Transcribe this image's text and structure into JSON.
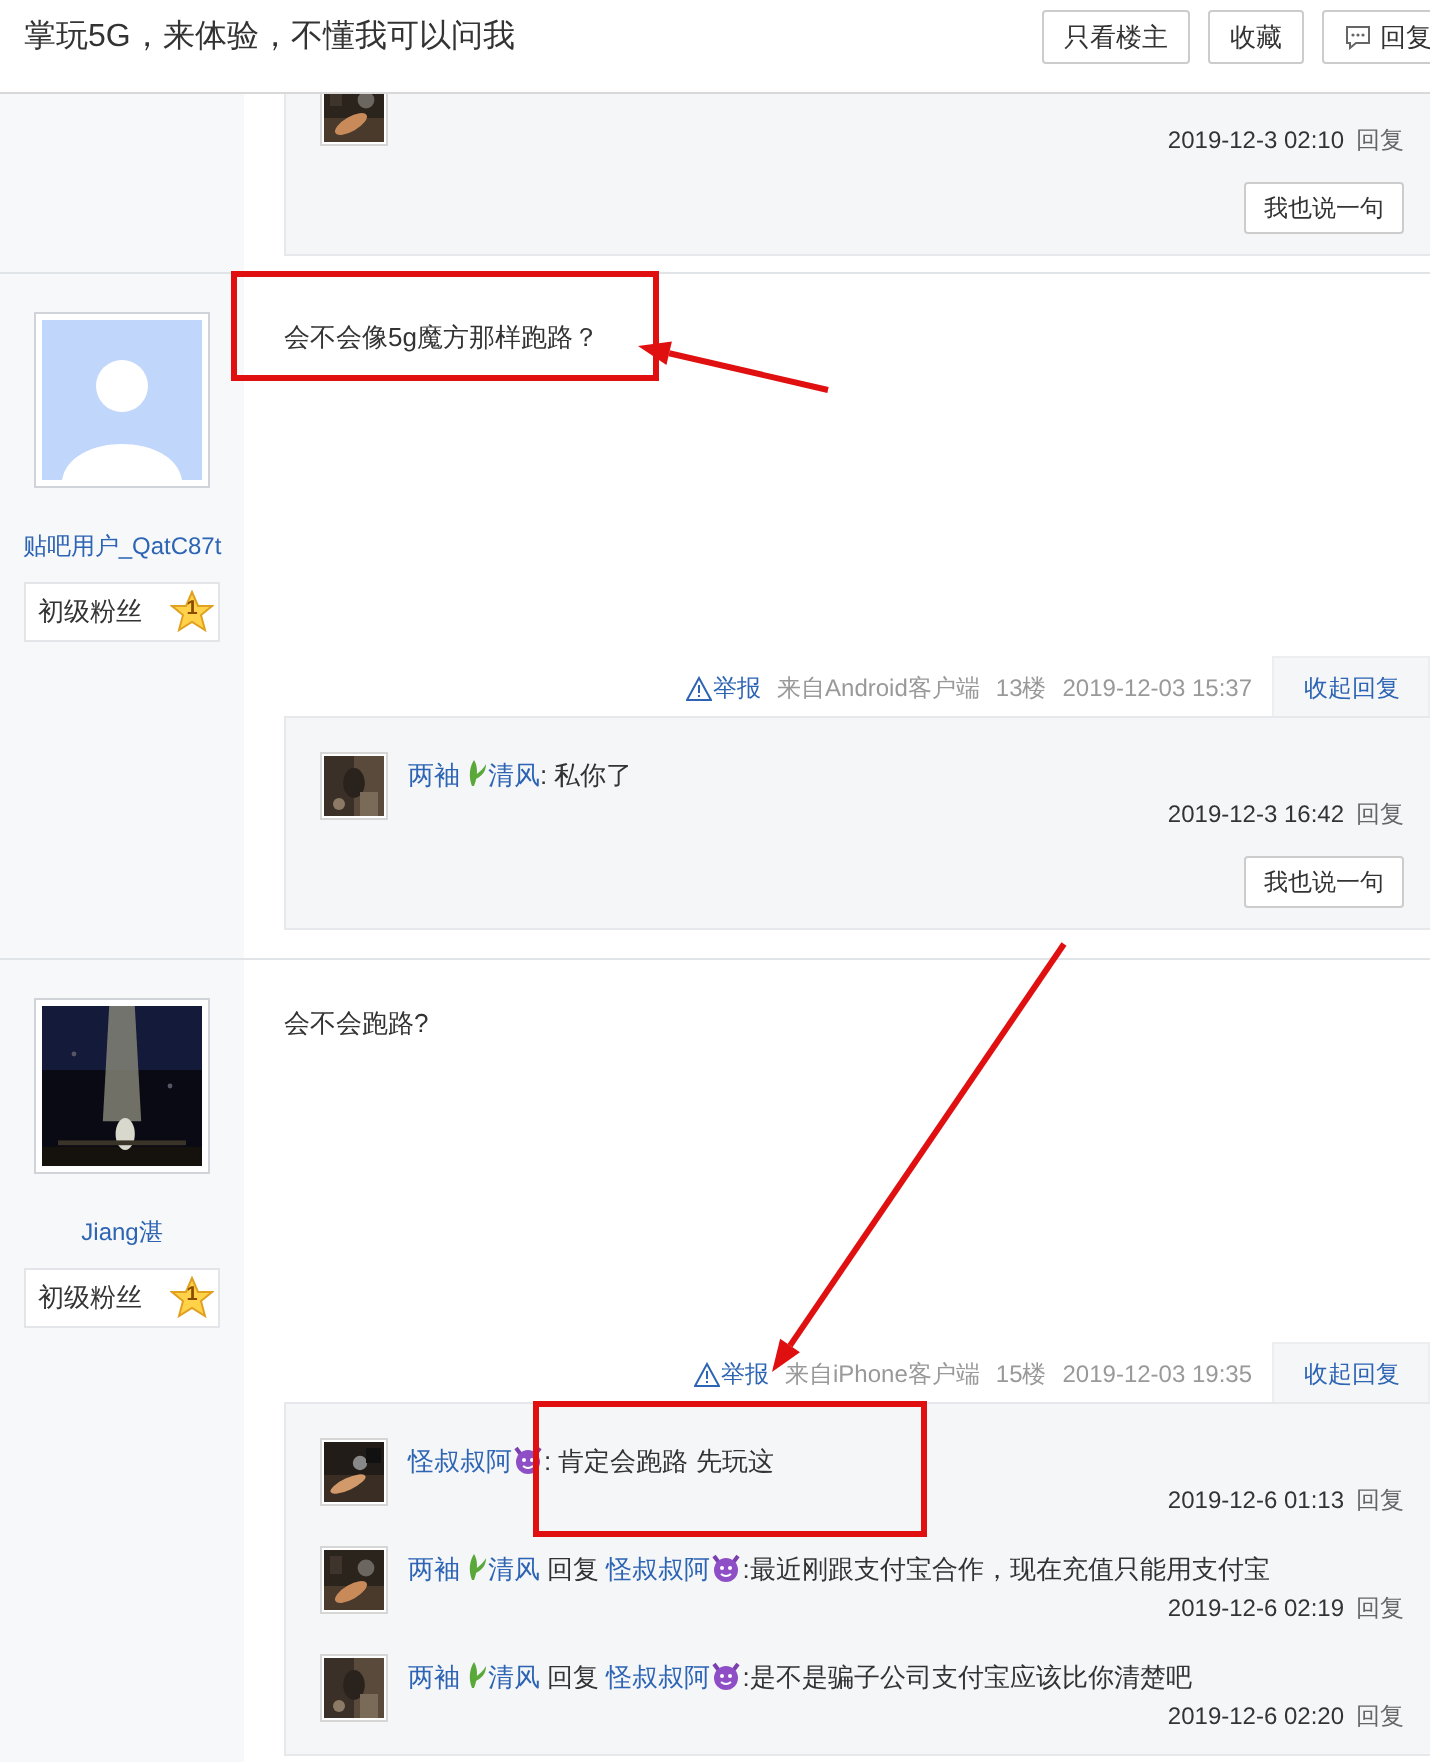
{
  "header": {
    "title": "掌玩5G，来体验，不懂我可以问我",
    "buttons": [
      {
        "label": "只看楼主",
        "icon": false
      },
      {
        "label": "收藏",
        "icon": false
      },
      {
        "label": "回复",
        "icon": true
      }
    ]
  },
  "posts": [
    {
      "kind": "continued",
      "replies": [
        {
          "time": "2019-12-3 02:10",
          "action": "回复"
        }
      ],
      "comment_button": "我也说一句"
    },
    {
      "kind": "full",
      "author": {
        "avatar": {
          "kind": "default"
        },
        "name": "贴吧用户_QatC87t",
        "rank": "初级粉丝",
        "level": "1"
      },
      "content": "会不会像5g魔方那样跑路？",
      "meta": {
        "report": "举报",
        "source": "来自Android客户端",
        "floor": "13楼",
        "time": "2019-12-03 15:37",
        "toggle": "收起回复"
      },
      "replies": [
        {
          "user": [
            {
              "text": "两袖",
              "badge": {
                "kind": "plant"
              }
            },
            {
              "text": "清风"
            }
          ],
          "text": ": 私你了",
          "time": "2019-12-3 16:42",
          "action": "回复"
        }
      ],
      "comment_button": "我也说一句"
    },
    {
      "kind": "full",
      "author": {
        "name": "Jiang湛",
        "rank": "初级粉丝",
        "level": "1"
      },
      "content": "会不会跑路?",
      "meta": {
        "report": "举报",
        "source": "来自iPhone客户端",
        "floor": "15楼",
        "time": "2019-12-03 19:35",
        "toggle": "收起回复"
      },
      "replies": [
        {
          "user": [
            {
              "text": "怪叔叔阿",
              "badge": {
                "kind": "devil"
              }
            }
          ],
          "text": ": 肯定会跑路 先玩这",
          "time": "2019-12-6 01:13",
          "action": "回复"
        },
        {
          "user": [
            {
              "text": "两袖",
              "badge": {
                "kind": "plant"
              }
            },
            {
              "text": "清风"
            }
          ],
          "reply_word": "回复",
          "reply_to": [
            {
              "text": "怪叔叔阿",
              "badge": {
                "kind": "devil"
              }
            }
          ],
          "text": ":最近刚跟支付宝合作，现在充值只能用支付宝",
          "time": "2019-12-6 02:19",
          "action": "回复"
        },
        {
          "user": [
            {
              "text": "两袖",
              "badge": {
                "kind": "plant"
              }
            },
            {
              "text": "清风"
            }
          ],
          "reply_word": "回复",
          "reply_to": [
            {
              "text": "怪叔叔阿",
              "badge": {
                "kind": "devil"
              }
            }
          ],
          "text": ":是不是骗子公司支付宝应该比你清楚吧",
          "time": "2019-12-6 02:20",
          "action": "回复"
        }
      ]
    }
  ]
}
